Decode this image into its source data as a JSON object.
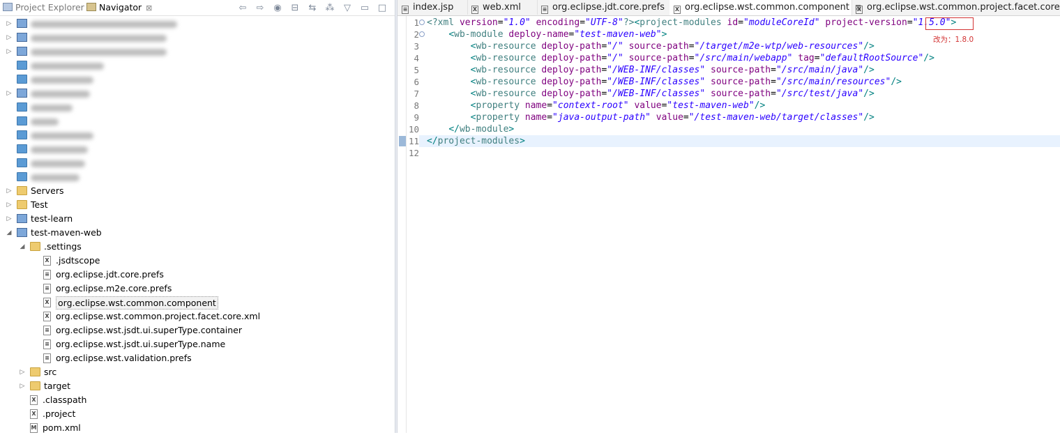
{
  "left_panel": {
    "tabs": [
      {
        "label": "Project Explorer",
        "active": false
      },
      {
        "label": "Navigator",
        "active": true,
        "close": "⊠"
      }
    ],
    "toolbar_icons": [
      "back-icon",
      "forward-icon",
      "home-icon",
      "collapse-all-icon",
      "link-with-editor-icon",
      "filters-icon",
      "view-menu-icon",
      "minimize-icon",
      "maximize-icon"
    ],
    "tree": [
      {
        "depth": 0,
        "kind": "project",
        "label": "",
        "blurred": true,
        "blur_w": 210,
        "expanded": false
      },
      {
        "depth": 0,
        "kind": "project",
        "label": "",
        "blurred": true,
        "blur_w": 195,
        "expanded": false
      },
      {
        "depth": 0,
        "kind": "project",
        "label": "",
        "blurred": true,
        "blur_w": 195,
        "expanded": false
      },
      {
        "depth": 0,
        "kind": "folder-blue",
        "label": "",
        "blurred": true,
        "blur_w": 105,
        "expanded": null
      },
      {
        "depth": 0,
        "kind": "folder-blue",
        "label": "",
        "blurred": true,
        "blur_w": 90,
        "expanded": null
      },
      {
        "depth": 0,
        "kind": "project",
        "label": "",
        "blurred": true,
        "blur_w": 85,
        "expanded": false
      },
      {
        "depth": 0,
        "kind": "folder-blue",
        "label": "",
        "blurred": true,
        "blur_w": 60,
        "expanded": null
      },
      {
        "depth": 0,
        "kind": "folder-blue",
        "label": "",
        "blurred": true,
        "blur_w": 40,
        "expanded": null
      },
      {
        "depth": 0,
        "kind": "folder-blue",
        "label": "",
        "blurred": true,
        "blur_w": 90,
        "expanded": null
      },
      {
        "depth": 0,
        "kind": "folder-blue",
        "label": "",
        "blurred": true,
        "blur_w": 82,
        "expanded": null
      },
      {
        "depth": 0,
        "kind": "folder-blue",
        "label": "",
        "blurred": true,
        "blur_w": 78,
        "expanded": null
      },
      {
        "depth": 0,
        "kind": "folder-blue",
        "label": "",
        "blurred": true,
        "blur_w": 70,
        "expanded": null
      },
      {
        "depth": 0,
        "kind": "folder",
        "label": "Servers",
        "expanded": false
      },
      {
        "depth": 0,
        "kind": "folder",
        "label": "Test",
        "expanded": false
      },
      {
        "depth": 0,
        "kind": "project",
        "label": "test-learn",
        "expanded": false
      },
      {
        "depth": 0,
        "kind": "project",
        "label": "test-maven-web",
        "expanded": true
      },
      {
        "depth": 1,
        "kind": "folder",
        "label": ".settings",
        "expanded": true
      },
      {
        "depth": 2,
        "kind": "xml",
        "label": ".jsdtscope"
      },
      {
        "depth": 2,
        "kind": "text",
        "label": "org.eclipse.jdt.core.prefs"
      },
      {
        "depth": 2,
        "kind": "text",
        "label": "org.eclipse.m2e.core.prefs"
      },
      {
        "depth": 2,
        "kind": "xml",
        "label": "org.eclipse.wst.common.component",
        "selected": true
      },
      {
        "depth": 2,
        "kind": "xml",
        "label": "org.eclipse.wst.common.project.facet.core.xml"
      },
      {
        "depth": 2,
        "kind": "text",
        "label": "org.eclipse.wst.jsdt.ui.superType.container"
      },
      {
        "depth": 2,
        "kind": "text",
        "label": "org.eclipse.wst.jsdt.ui.superType.name"
      },
      {
        "depth": 2,
        "kind": "text",
        "label": "org.eclipse.wst.validation.prefs"
      },
      {
        "depth": 1,
        "kind": "folder",
        "label": "src",
        "expanded": false
      },
      {
        "depth": 1,
        "kind": "folder",
        "label": "target",
        "expanded": false
      },
      {
        "depth": 1,
        "kind": "xml",
        "label": ".classpath"
      },
      {
        "depth": 1,
        "kind": "xml",
        "label": ".project"
      },
      {
        "depth": 1,
        "kind": "maven",
        "label": "pom.xml"
      }
    ]
  },
  "editor": {
    "tabs": [
      {
        "label": "index.jsp",
        "icon": "text",
        "active": false
      },
      {
        "label": "web.xml",
        "icon": "xml",
        "active": false
      },
      {
        "label": "org.eclipse.jdt.core.prefs",
        "icon": "text",
        "active": false
      },
      {
        "label": "org.eclipse.wst.common.component",
        "icon": "xml",
        "active": true,
        "close": "⊠"
      },
      {
        "label": "org.eclipse.wst.common.project.facet.core.xml",
        "icon": "xml",
        "active": false
      }
    ],
    "lines": [
      [
        [
          "#3f7f7f",
          "<?"
        ],
        [
          "#3f7f7f",
          "xml "
        ],
        [
          "#7f007f",
          "version"
        ],
        [
          "#000",
          "="
        ],
        [
          "#2a00ff",
          "\"1.0\""
        ],
        [
          "#000",
          " "
        ],
        [
          "#7f007f",
          "encoding"
        ],
        [
          "#000",
          "="
        ],
        [
          "#2a00ff",
          "\"UTF-8\""
        ],
        [
          "#3f7f7f",
          "?>"
        ],
        [
          "#008080",
          "<"
        ],
        [
          "#3f7f7f",
          "project-modules "
        ],
        [
          "#7f007f",
          "id"
        ],
        [
          "#000",
          "="
        ],
        [
          "#2a00ff",
          "\"moduleCoreId\""
        ],
        [
          "#000",
          " "
        ],
        [
          "#7f007f",
          "project-version"
        ],
        [
          "#000",
          "="
        ],
        [
          "#2a00ff",
          "\"1.5.0\""
        ],
        [
          "#008080",
          ">"
        ]
      ],
      [
        [
          "#000",
          "    "
        ],
        [
          "#008080",
          "<"
        ],
        [
          "#3f7f7f",
          "wb-module "
        ],
        [
          "#7f007f",
          "deploy-name"
        ],
        [
          "#000",
          "="
        ],
        [
          "#2a00ff",
          "\"test-maven-web\""
        ],
        [
          "#008080",
          ">"
        ]
      ],
      [
        [
          "#000",
          "        "
        ],
        [
          "#008080",
          "<"
        ],
        [
          "#3f7f7f",
          "wb-resource "
        ],
        [
          "#7f007f",
          "deploy-path"
        ],
        [
          "#000",
          "="
        ],
        [
          "#2a00ff",
          "\"/\""
        ],
        [
          "#000",
          " "
        ],
        [
          "#7f007f",
          "source-path"
        ],
        [
          "#000",
          "="
        ],
        [
          "#2a00ff",
          "\"/target/m2e-wtp/web-resources\""
        ],
        [
          "#008080",
          "/>"
        ]
      ],
      [
        [
          "#000",
          "        "
        ],
        [
          "#008080",
          "<"
        ],
        [
          "#3f7f7f",
          "wb-resource "
        ],
        [
          "#7f007f",
          "deploy-path"
        ],
        [
          "#000",
          "="
        ],
        [
          "#2a00ff",
          "\"/\""
        ],
        [
          "#000",
          " "
        ],
        [
          "#7f007f",
          "source-path"
        ],
        [
          "#000",
          "="
        ],
        [
          "#2a00ff",
          "\"/src/main/webapp\""
        ],
        [
          "#000",
          " "
        ],
        [
          "#7f007f",
          "tag"
        ],
        [
          "#000",
          "="
        ],
        [
          "#2a00ff",
          "\"defaultRootSource\""
        ],
        [
          "#008080",
          "/>"
        ]
      ],
      [
        [
          "#000",
          "        "
        ],
        [
          "#008080",
          "<"
        ],
        [
          "#3f7f7f",
          "wb-resource "
        ],
        [
          "#7f007f",
          "deploy-path"
        ],
        [
          "#000",
          "="
        ],
        [
          "#2a00ff",
          "\"/WEB-INF/classes\""
        ],
        [
          "#000",
          " "
        ],
        [
          "#7f007f",
          "source-path"
        ],
        [
          "#000",
          "="
        ],
        [
          "#2a00ff",
          "\"/src/main/java\""
        ],
        [
          "#008080",
          "/>"
        ]
      ],
      [
        [
          "#000",
          "        "
        ],
        [
          "#008080",
          "<"
        ],
        [
          "#3f7f7f",
          "wb-resource "
        ],
        [
          "#7f007f",
          "deploy-path"
        ],
        [
          "#000",
          "="
        ],
        [
          "#2a00ff",
          "\"/WEB-INF/classes\""
        ],
        [
          "#000",
          " "
        ],
        [
          "#7f007f",
          "source-path"
        ],
        [
          "#000",
          "="
        ],
        [
          "#2a00ff",
          "\"/src/main/resources\""
        ],
        [
          "#008080",
          "/>"
        ]
      ],
      [
        [
          "#000",
          "        "
        ],
        [
          "#008080",
          "<"
        ],
        [
          "#3f7f7f",
          "wb-resource "
        ],
        [
          "#7f007f",
          "deploy-path"
        ],
        [
          "#000",
          "="
        ],
        [
          "#2a00ff",
          "\"/WEB-INF/classes\""
        ],
        [
          "#000",
          " "
        ],
        [
          "#7f007f",
          "source-path"
        ],
        [
          "#000",
          "="
        ],
        [
          "#2a00ff",
          "\"/src/test/java\""
        ],
        [
          "#008080",
          "/>"
        ]
      ],
      [
        [
          "#000",
          "        "
        ],
        [
          "#008080",
          "<"
        ],
        [
          "#3f7f7f",
          "property "
        ],
        [
          "#7f007f",
          "name"
        ],
        [
          "#000",
          "="
        ],
        [
          "#2a00ff",
          "\"context-root\""
        ],
        [
          "#000",
          " "
        ],
        [
          "#7f007f",
          "value"
        ],
        [
          "#000",
          "="
        ],
        [
          "#2a00ff",
          "\"test-maven-web\""
        ],
        [
          "#008080",
          "/>"
        ]
      ],
      [
        [
          "#000",
          "        "
        ],
        [
          "#008080",
          "<"
        ],
        [
          "#3f7f7f",
          "property "
        ],
        [
          "#7f007f",
          "name"
        ],
        [
          "#000",
          "="
        ],
        [
          "#2a00ff",
          "\"java-output-path\""
        ],
        [
          "#000",
          " "
        ],
        [
          "#7f007f",
          "value"
        ],
        [
          "#000",
          "="
        ],
        [
          "#2a00ff",
          "\"/test-maven-web/target/classes\""
        ],
        [
          "#008080",
          "/>"
        ]
      ],
      [
        [
          "#000",
          "    "
        ],
        [
          "#008080",
          "</"
        ],
        [
          "#3f7f7f",
          "wb-module"
        ],
        [
          "#008080",
          ">"
        ]
      ],
      [
        [
          "#008080",
          "</"
        ],
        [
          "#3f7f7f",
          "project-modules"
        ],
        [
          "#008080",
          ">"
        ]
      ],
      []
    ],
    "line_numbers": [
      "1",
      "2",
      "3",
      "4",
      "5",
      "6",
      "7",
      "8",
      "9",
      "10",
      "11",
      "12"
    ],
    "fold_lines": [
      0,
      1
    ],
    "annotation": {
      "text": "改为：1.8.0",
      "color": "#d23232"
    }
  },
  "colors": {
    "selection": "#f2f2f2",
    "current_line": "#e8f2fe",
    "folder": "#eecb6f",
    "folder_blue": "#5b9bd5"
  }
}
